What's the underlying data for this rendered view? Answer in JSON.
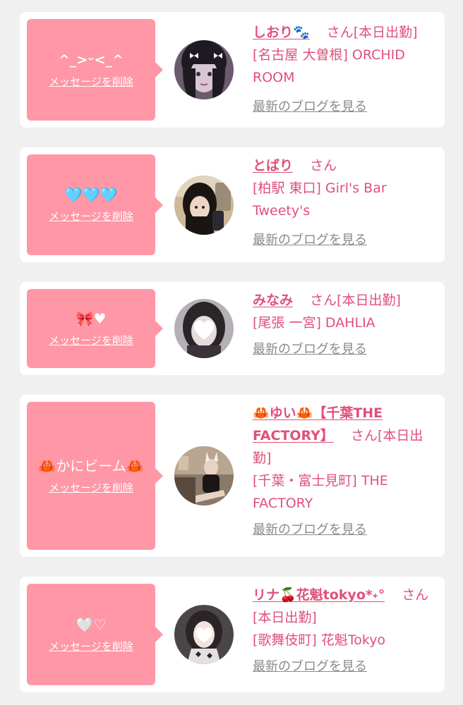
{
  "colors": {
    "background": "#f0f0f0",
    "card": "#ffffff",
    "bubble": "#ff97a6",
    "accent": "#e0507a",
    "link_gray": "#8a8a8a"
  },
  "delete_label": "メッセージを削除",
  "blog_label": "最新のブログを見る",
  "honorific": "さん",
  "entries": [
    {
      "message": "^_>ᵕ<_^",
      "name": "しおり🐾",
      "status": "[本日出勤]",
      "store": "[名古屋 大曽根] ORCHID ROOM"
    },
    {
      "message": "🩵🩵🩵",
      "name": "とばり",
      "status": "",
      "store": "[柏駅 東口] Girl's Bar Tweety's"
    },
    {
      "message": "🎀♥",
      "name": "みなみ",
      "status": "[本日出勤]",
      "store": "[尾張 一宮] DAHLIA"
    },
    {
      "message": "🦀かにビーム🦀",
      "name": "🦀ゆい🦀【千葉THE FACTORY】",
      "status": "[本日出勤]",
      "store": "[千葉・富士見町] THE FACTORY"
    },
    {
      "message": "🤍♡",
      "name": "リナ🍒花魁tokyo*˖°",
      "status": "[本日出勤]",
      "store": "[歌舞伎町] 花魁Tokyo"
    }
  ]
}
